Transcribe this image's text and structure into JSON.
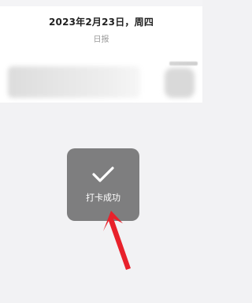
{
  "header": {
    "date": "2023年2月23日，周四",
    "subtitle": "日报"
  },
  "toast": {
    "icon": "check-icon",
    "message": "打卡成功"
  },
  "annotation": {
    "arrow_color": "#e8212b"
  },
  "colors": {
    "page_background": "#f2f2f4",
    "card_background": "#ffffff",
    "toast_background": "#747474"
  }
}
